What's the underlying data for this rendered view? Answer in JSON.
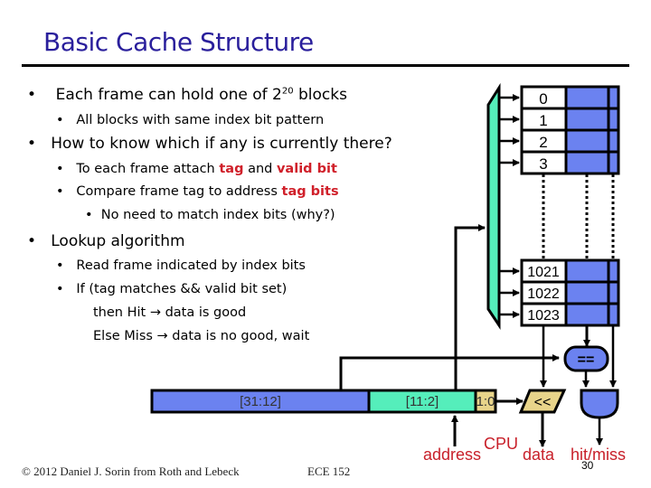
{
  "slide": {
    "title": "Basic Cache Structure",
    "bullets": [
      {
        "level": 1,
        "text_before": "Each frame can hold one of 2",
        "sup": "20",
        "text_after": " blocks"
      },
      {
        "level": 2,
        "text": "All blocks with same index bit pattern"
      },
      {
        "level": 1,
        "text": "How to know which if any is currently there?"
      },
      {
        "level": 2,
        "parts": [
          {
            "t": "To each frame attach "
          },
          {
            "t": "tag",
            "em": true
          },
          {
            "t": " and "
          },
          {
            "t": "valid bit",
            "em": true
          }
        ]
      },
      {
        "level": 2,
        "parts": [
          {
            "t": "Compare frame tag to address "
          },
          {
            "t": "tag bits",
            "em": true
          }
        ]
      },
      {
        "level": 3,
        "text": "No need to match index bits (why?)"
      },
      {
        "level": 1,
        "text": "Lookup algorithm"
      },
      {
        "level": 2,
        "text": "Read frame indicated by index bits"
      },
      {
        "level": 2,
        "text": "If (tag matches && valid bit set)"
      },
      {
        "level": "cont",
        "text": "then Hit → data is good"
      },
      {
        "level": "cont",
        "text": "Else Miss → data is no good, wait"
      }
    ],
    "bullet_glyph": "•",
    "footer": {
      "credit": "© 2012 Daniel J. Sorin from Roth and Lebeck",
      "course": "ECE 152",
      "page": "30"
    }
  },
  "diagram": {
    "cache_rows_top": [
      "0",
      "1",
      "2",
      "3"
    ],
    "cache_rows_bottom": [
      "1021",
      "1022",
      "1023"
    ],
    "address_fields": [
      {
        "label": "[31:12]",
        "role": "tag"
      },
      {
        "label": "[11:2]",
        "role": "index"
      },
      {
        "label": "1:0",
        "role": "offset"
      }
    ],
    "comparator_label": "==",
    "shifter_label": "<<",
    "labels": {
      "cpu": "CPU",
      "address": "address",
      "data": "data",
      "hit_miss": "hit/miss"
    },
    "colors": {
      "title": "#2a1f9c",
      "tag_field": "#6b82f0",
      "index_field": "#55eebb",
      "offset_field": "#e8d48a",
      "emphasis": "#d0202a",
      "decoder": "#55eebb"
    }
  }
}
